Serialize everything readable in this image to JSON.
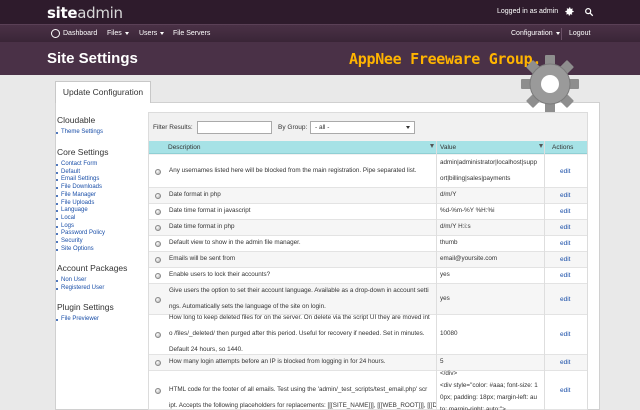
{
  "app": {
    "logo_bold": "site",
    "logo_light": "admin",
    "logged_in": "Logged in as admin"
  },
  "nav": {
    "dashboard": "Dashboard",
    "files": "Files",
    "users": "Users",
    "file_servers": "File Servers",
    "configuration": "Configuration",
    "logout": "Logout"
  },
  "page": {
    "title": "Site Settings",
    "watermark": "AppNee Freeware Group.",
    "update_tab": "Update Configuration"
  },
  "sidebar": {
    "sections": [
      {
        "title": "Cloudable",
        "items": [
          "Theme Settings"
        ]
      },
      {
        "title": "Core Settings",
        "items": [
          "Contact Form",
          "Default",
          "Email Settings",
          "File Downloads",
          "File Manager",
          "File Uploads",
          "Language",
          "Local",
          "Logs",
          "Password Policy",
          "Security",
          "Site Options"
        ]
      },
      {
        "title": "Account Packages",
        "items": [
          "Non User",
          "Registered User"
        ]
      },
      {
        "title": "Plugin Settings",
        "items": [
          "File Previewer"
        ]
      }
    ]
  },
  "filters": {
    "filter_label": "Filter Results:",
    "group_label": "By Group:",
    "group_value": "- all -"
  },
  "table": {
    "headers": {
      "description": "Description",
      "value": "Value",
      "actions": "Actions"
    },
    "edit_label": "edit",
    "rows": [
      {
        "desc": [
          "Any usernames listed here will be blocked from the main registration. Pipe separated list."
        ],
        "value": [
          "admin|administrator|localhost|supp",
          "ort|billing|sales|payments"
        ]
      },
      {
        "desc": [
          "Date format in php"
        ],
        "value": [
          "d/m/Y"
        ]
      },
      {
        "desc": [
          "Date time format in javascript"
        ],
        "value": [
          "%d-%m-%Y %H:%i"
        ]
      },
      {
        "desc": [
          "Date time format in php"
        ],
        "value": [
          "d/m/Y H:i:s"
        ]
      },
      {
        "desc": [
          "Default view to show in the admin file manager."
        ],
        "value": [
          "thumb"
        ]
      },
      {
        "desc": [
          "Emails will be sent from"
        ],
        "value": [
          "email@yoursite.com"
        ]
      },
      {
        "desc": [
          "Enable users to lock their accounts?"
        ],
        "value": [
          "yes"
        ]
      },
      {
        "desc": [
          "Give users the option to set their account language. Available as a drop-down in account setti",
          "ngs. Automatically sets the language of the site on login."
        ],
        "value": [
          "yes"
        ]
      },
      {
        "desc": [
          "How long to keep deleted files for on the server. On delete via the script UI they are moved int",
          "o /files/_deleted/ then purged after this period. Useful for recovery if needed. Set in minutes.",
          "Default 24 hours, so 1440."
        ],
        "value": [
          "10080"
        ]
      },
      {
        "desc": [
          "How many login attempts before an IP is blocked from logging in for 24 hours."
        ],
        "value": [
          "5"
        ]
      },
      {
        "desc": [
          "",
          "HTML code for the footer of all emails. Test using the 'admin/_test_scripts/test_email.php' scr",
          "ipt. Accepts the following placeholders for replacements: [[[SITE_NAME]]], [[[WEB_ROOT]]], [[[D"
        ],
        "value": [
          "</div>",
          "<div style=\"color: #aaa; font-size: 1",
          "0px; padding: 18px; margin-left: au",
          "to; margin-right: auto;\">"
        ]
      }
    ]
  },
  "colors": {
    "topbar": "#2e1b2c",
    "header": "#4a3147",
    "accent": "#ffb400",
    "link": "#1a4fa8",
    "table_head": "#a6e2e6"
  }
}
